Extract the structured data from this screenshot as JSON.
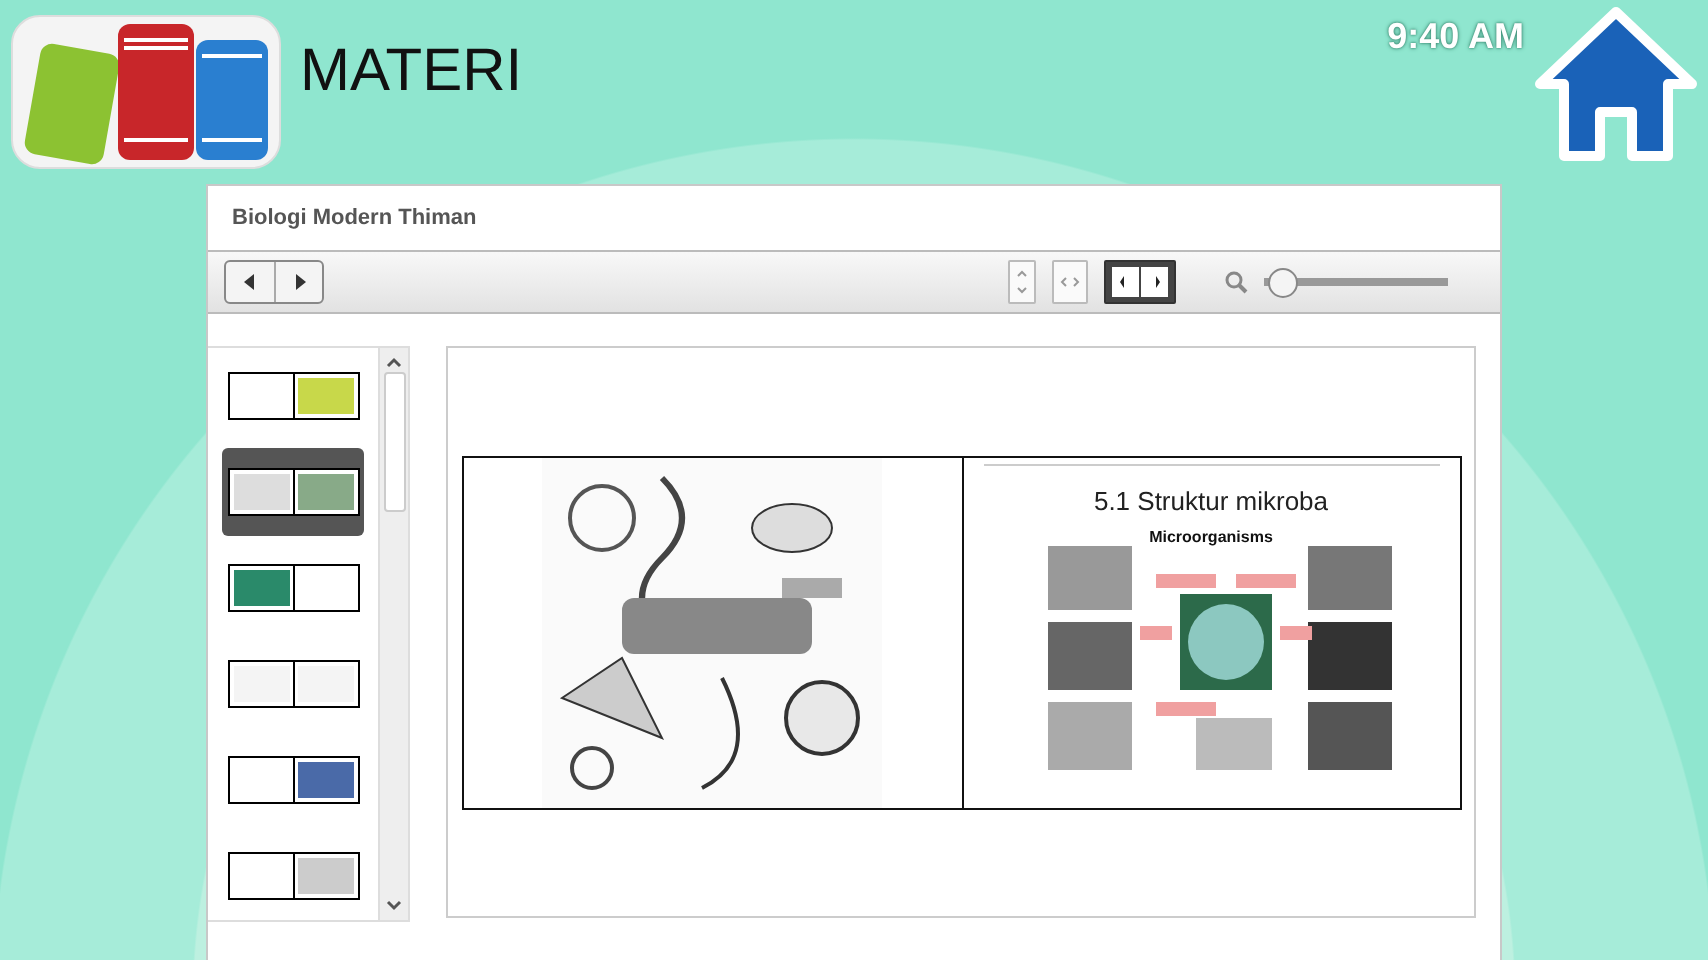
{
  "app": {
    "title": "MATERI",
    "clock": "9:40 AM"
  },
  "viewer": {
    "title": "Biologi Modern Thiman",
    "view_modes": [
      {
        "kind": "vertical",
        "selected": false
      },
      {
        "kind": "horizontal",
        "selected": false
      },
      {
        "kind": "spread",
        "selected": true
      }
    ],
    "zoom": {
      "level": 0.03
    },
    "thumbnails": [
      {
        "selected": false
      },
      {
        "selected": true
      },
      {
        "selected": false
      },
      {
        "selected": false
      },
      {
        "selected": false
      },
      {
        "selected": false
      }
    ],
    "spread": {
      "right_page": {
        "heading": "5.1 Struktur mikroba",
        "diagram_title": "Microorganisms"
      }
    }
  }
}
